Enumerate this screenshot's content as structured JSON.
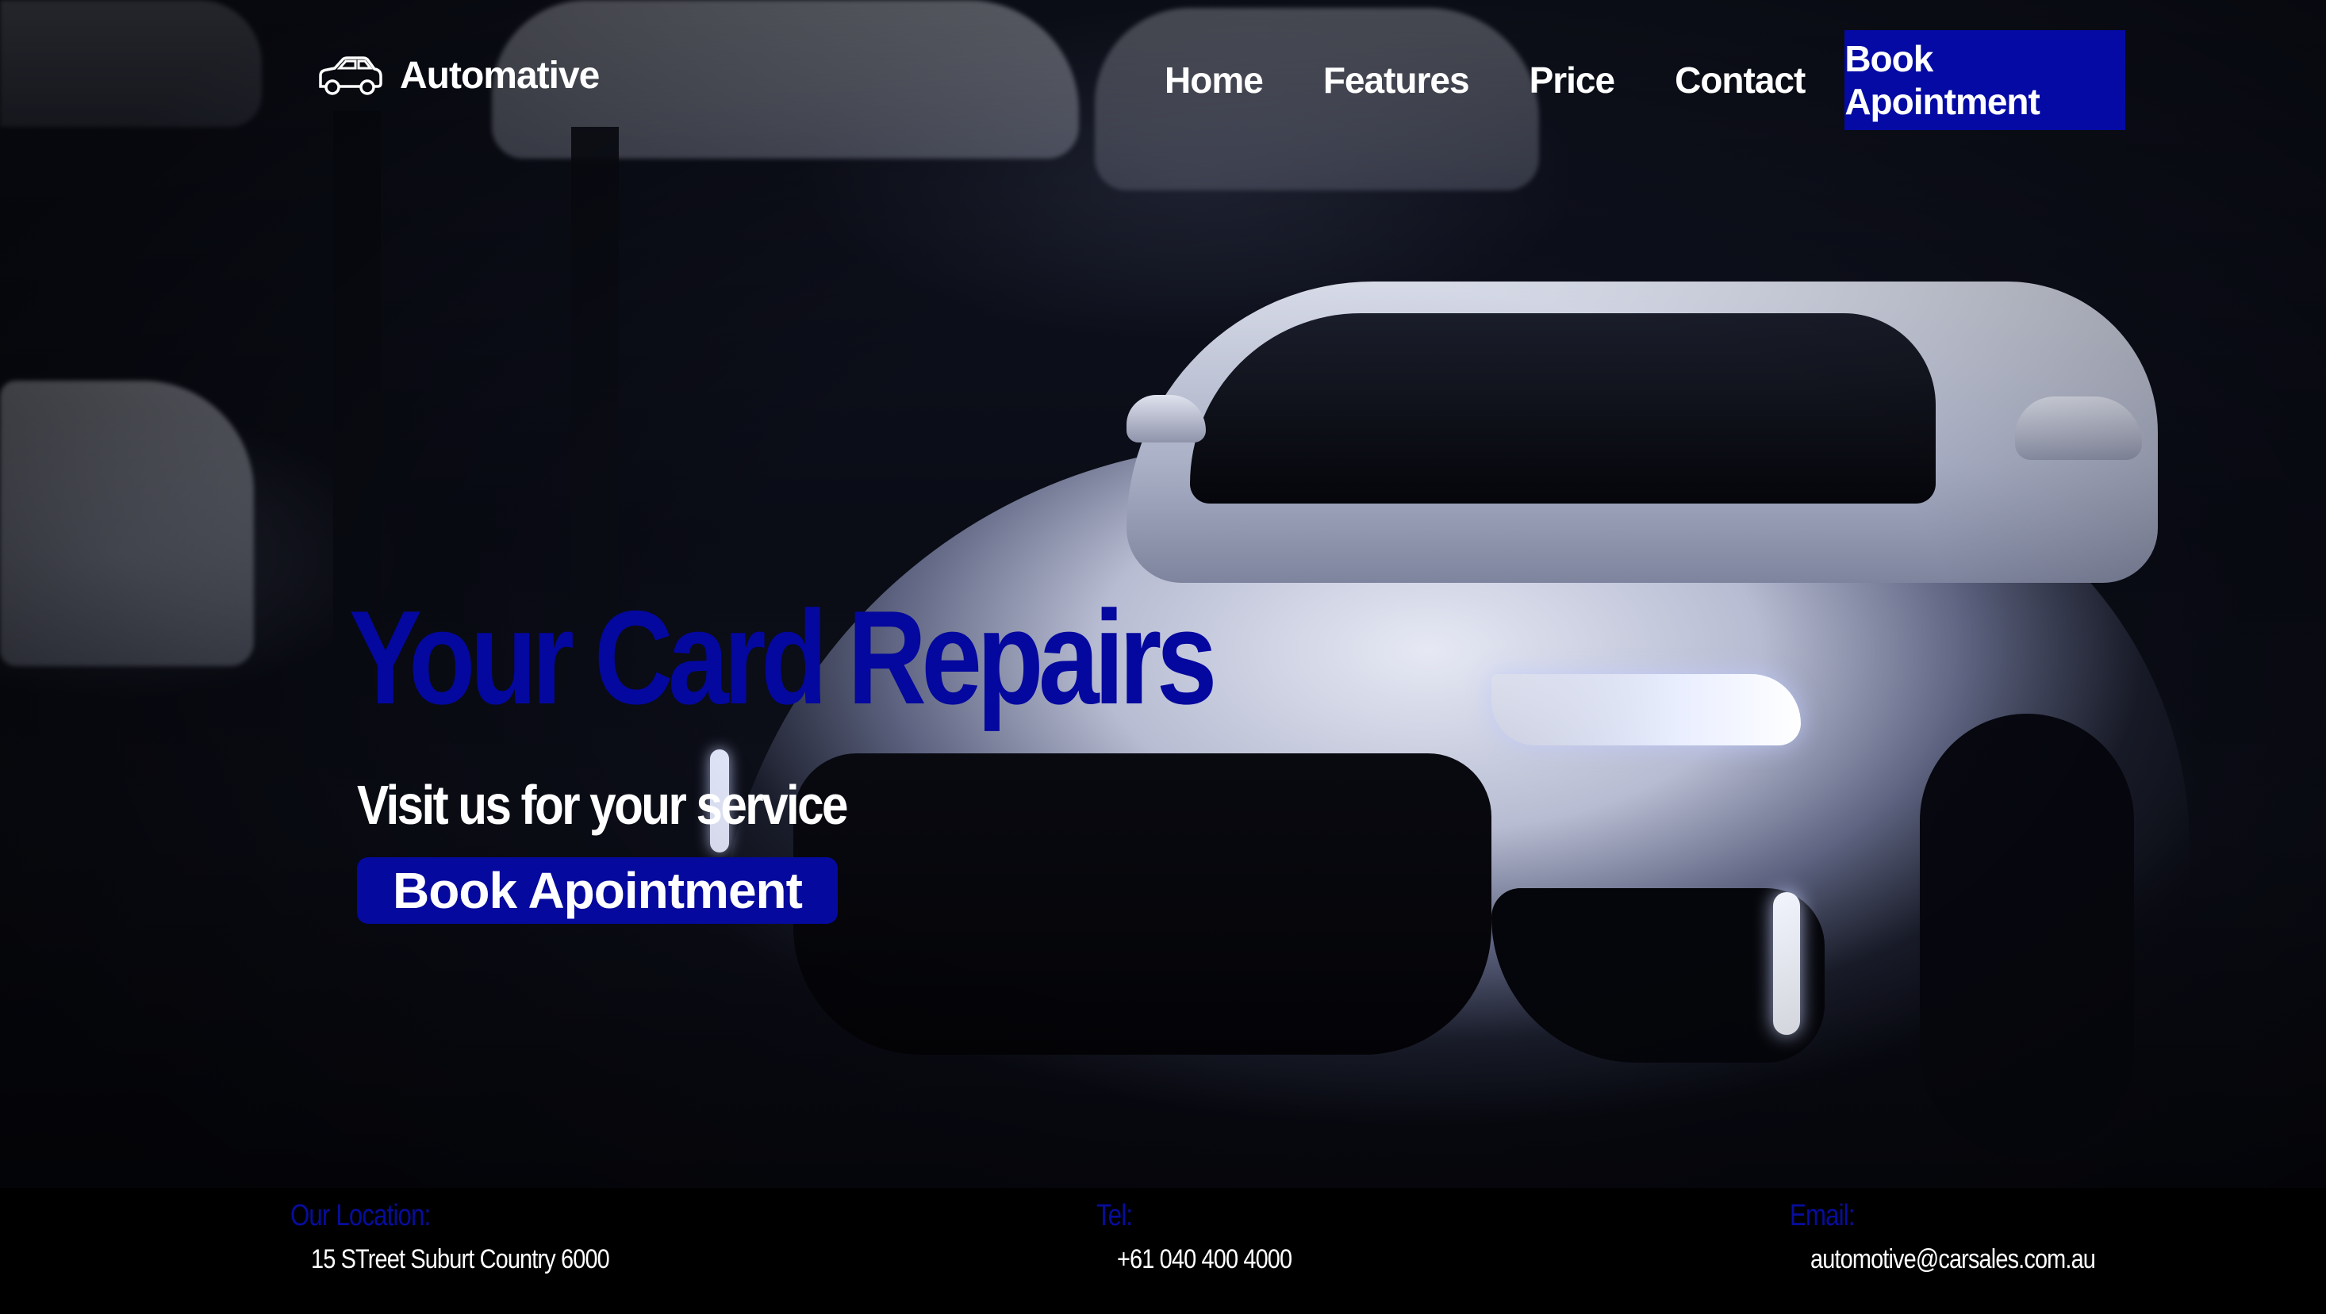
{
  "brand": {
    "name": "Automative",
    "icon": "car-outline-icon"
  },
  "nav": {
    "links": [
      "Home",
      "Features",
      "Price",
      "Contact"
    ],
    "cta_label": "Book Apointment"
  },
  "hero": {
    "title": "Your Card Repairs",
    "subtitle": "Visit us for your service",
    "cta_label": "Book Apointment"
  },
  "footer": {
    "location_label": "Our Location:",
    "location_value": "15 STreet Suburt Country 6000",
    "tel_label": "Tel:",
    "tel_value": "+61 040 400 4000",
    "email_label": "Email:",
    "email_value": "automotive@carsales.com.au"
  },
  "colors": {
    "accent": "#04089e",
    "text": "#ffffff",
    "footer_bg": "#000000"
  }
}
